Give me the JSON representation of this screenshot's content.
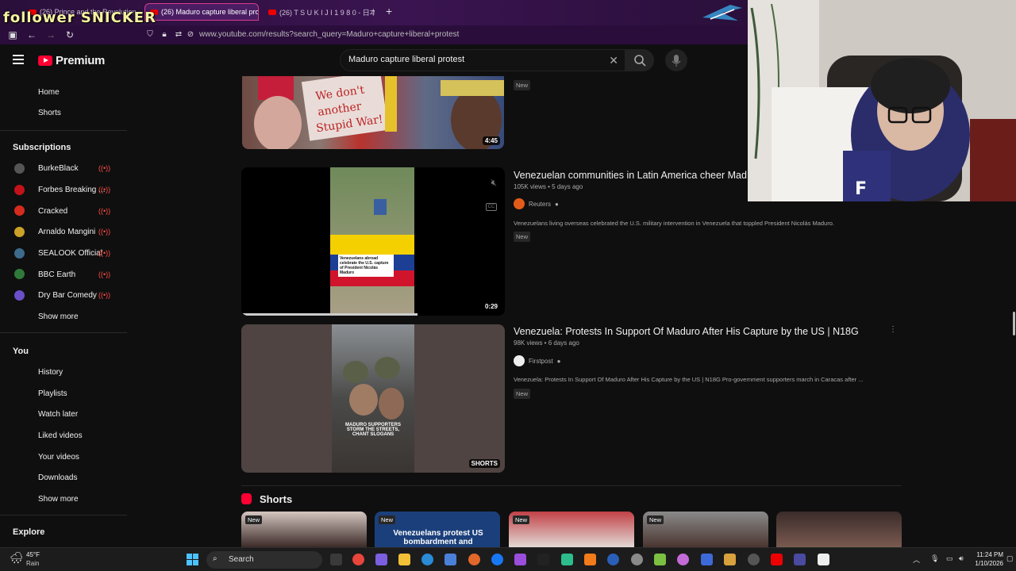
{
  "overlay": {
    "text": "follower SNICKER"
  },
  "browser": {
    "tabs": [
      {
        "label": "(26) Prince and the Revolution",
        "active": false
      },
      {
        "label": "(26) Maduro capture liberal pro",
        "active": true
      },
      {
        "label": "(26) T S U K I J I  1 9 8 0 - 日本",
        "active": false
      }
    ],
    "url": "www.youtube.com/results?search_query=Maduro+capture+liberal+protest"
  },
  "header": {
    "logo": "Premium",
    "search_value": "Maduro capture liberal protest"
  },
  "sidebar": {
    "main": [
      "Home",
      "Shorts"
    ],
    "subscriptions_heading": "Subscriptions",
    "subscriptions": [
      {
        "name": "BurkeBlack",
        "color": "#555555"
      },
      {
        "name": "Forbes Breaking ...",
        "color": "#c4121a"
      },
      {
        "name": "Cracked",
        "color": "#d42b1e"
      },
      {
        "name": "Arnaldo Mangini",
        "color": "#c9a227"
      },
      {
        "name": "SEALOOK Official",
        "color": "#3d6b8c"
      },
      {
        "name": "BBC Earth",
        "color": "#2f7a3a"
      },
      {
        "name": "Dry Bar Comedy",
        "color": "#6a4fc8"
      }
    ],
    "show_more": "Show more",
    "you_heading": "You",
    "you_items": [
      "History",
      "Playlists",
      "Watch later",
      "Liked videos",
      "Your videos",
      "Downloads"
    ],
    "show_more_2": "Show more",
    "explore_heading": "Explore"
  },
  "results": {
    "first": {
      "duration": "4:45",
      "new_badge": "New"
    },
    "second": {
      "title": "Venezuelan communities in Latin America cheer Madur",
      "meta": "105K views • 5 days ago",
      "channel": "Reuters",
      "description": "Venezuelans living overseas celebrated the U.S. military intervention in Venezuela that toppled President Nicolás Maduro.",
      "new_badge": "New",
      "duration": "0:29",
      "caption": "Venezuelans abroad celebrate the U.S. capture of President Nicolás Maduro"
    },
    "third": {
      "title": "Venezuela: Protests In Support Of Maduro After His Capture by the US | N18G",
      "meta": "98K views • 6 days ago",
      "channel": "Firstpost",
      "description": "Venezuela: Protests In Support Of Maduro After His Capture by the US | N18G Pro-government supporters march in Caracas after ...",
      "new_badge": "New",
      "label": "SHORTS",
      "caption": "MADURO SUPPORTERS STORM THE STREETS, CHANT SLOGANS"
    }
  },
  "shorts": {
    "heading": "Shorts",
    "items": [
      {
        "badge": "New",
        "text": ""
      },
      {
        "badge": "New",
        "text": "Venezuelans protest US bombardment and"
      },
      {
        "badge": "New",
        "text": ""
      },
      {
        "badge": "New",
        "text": ""
      },
      {
        "badge": "",
        "text": ""
      }
    ]
  },
  "taskbar": {
    "weather_temp": "45°F",
    "weather_desc": "Rain",
    "search_label": "Search",
    "time": "11:24 PM",
    "date": "1/10/2026"
  }
}
